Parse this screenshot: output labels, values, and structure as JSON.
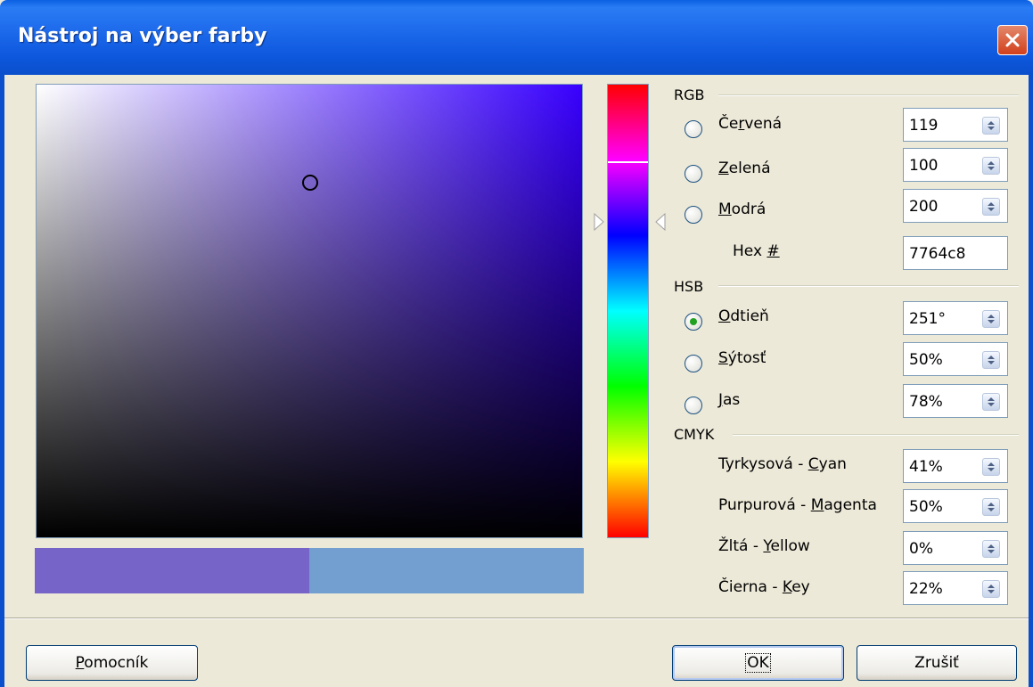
{
  "window": {
    "title": "Nástroj na výber farby"
  },
  "colors": {
    "new": "#7764c8",
    "old": "#729fcf",
    "title_bar": "#0a4fcc"
  },
  "rgb": {
    "label": "RGB",
    "red": {
      "label_pre": "Če",
      "label_acc": "r",
      "label_post": "vená",
      "value": "119"
    },
    "green": {
      "label_pre": "",
      "label_acc": "Z",
      "label_post": "elená",
      "value": "100"
    },
    "blue": {
      "label_pre": "",
      "label_acc": "M",
      "label_post": "odrá",
      "value": "200"
    },
    "hex": {
      "label_pre": "Hex ",
      "label_acc": "#",
      "value": "7764c8"
    }
  },
  "hsb": {
    "label": "HSB",
    "hue": {
      "label_acc": "O",
      "label_post": "dtieň",
      "value": "251°",
      "selected": true
    },
    "saturation": {
      "label_acc": "S",
      "label_post": "ýtosť",
      "value": "50%"
    },
    "brightness": {
      "label_acc": "J",
      "label_post": "as",
      "value": "78%"
    }
  },
  "cmyk": {
    "label": "CMYK",
    "cyan": {
      "label_pre": "Tyrkysová - ",
      "label_acc": "C",
      "label_post": "yan",
      "value": "41%"
    },
    "magenta": {
      "label_pre": "Purpurová - ",
      "label_acc": "M",
      "label_post": "agenta",
      "value": "50%"
    },
    "yellow": {
      "label_pre": "Žltá - ",
      "label_acc": "Y",
      "label_post": "ellow",
      "value": "0%"
    },
    "key": {
      "label_pre": "Čierna - ",
      "label_acc": "K",
      "label_post": "ey",
      "value": "22%"
    }
  },
  "buttons": {
    "help": {
      "acc": "P",
      "rest": "omocník"
    },
    "ok": "OK",
    "cancel": "Zrušiť"
  }
}
